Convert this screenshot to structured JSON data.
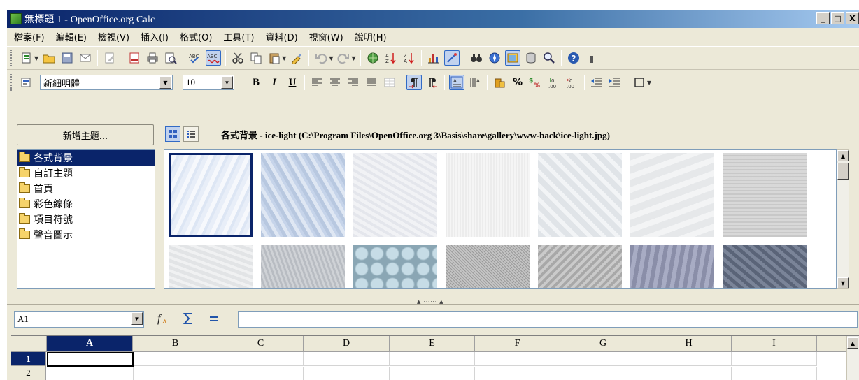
{
  "window": {
    "title": "無標題 1 - OpenOffice.org Calc",
    "controls": [
      "_",
      "□",
      "X"
    ]
  },
  "menu": [
    "檔案(F)",
    "編輯(E)",
    "檢視(V)",
    "插入(I)",
    "格式(O)",
    "工具(T)",
    "資料(D)",
    "視窗(W)",
    "說明(H)"
  ],
  "formatting": {
    "font_name": "新細明體",
    "font_size": "10",
    "bold": "B",
    "italic": "I",
    "underline": "U",
    "percent": "%"
  },
  "gallery": {
    "new_theme_label": "新增主題...",
    "title": "各式背景 - ice-light (C:\\Program Files\\OpenOffice.org 3\\Basis\\share\\gallery\\www-back\\ice-light.jpg)",
    "themes": [
      {
        "label": "各式背景",
        "selected": true
      },
      {
        "label": "自訂主題",
        "selected": false
      },
      {
        "label": "首頁",
        "selected": false
      },
      {
        "label": "彩色線條",
        "selected": false
      },
      {
        "label": "項目符號",
        "selected": false
      },
      {
        "label": "聲音圖示",
        "selected": false
      }
    ]
  },
  "formula_bar": {
    "cell_ref": "A1",
    "formula": ""
  },
  "sheet": {
    "columns": [
      "A",
      "B",
      "C",
      "D",
      "E",
      "F",
      "G",
      "H",
      "I"
    ],
    "rows": [
      "1",
      "2"
    ],
    "selected_column": "A",
    "selected_row": "1"
  },
  "colors": {
    "selection": "#0a246a",
    "face": "#ece9d8"
  }
}
